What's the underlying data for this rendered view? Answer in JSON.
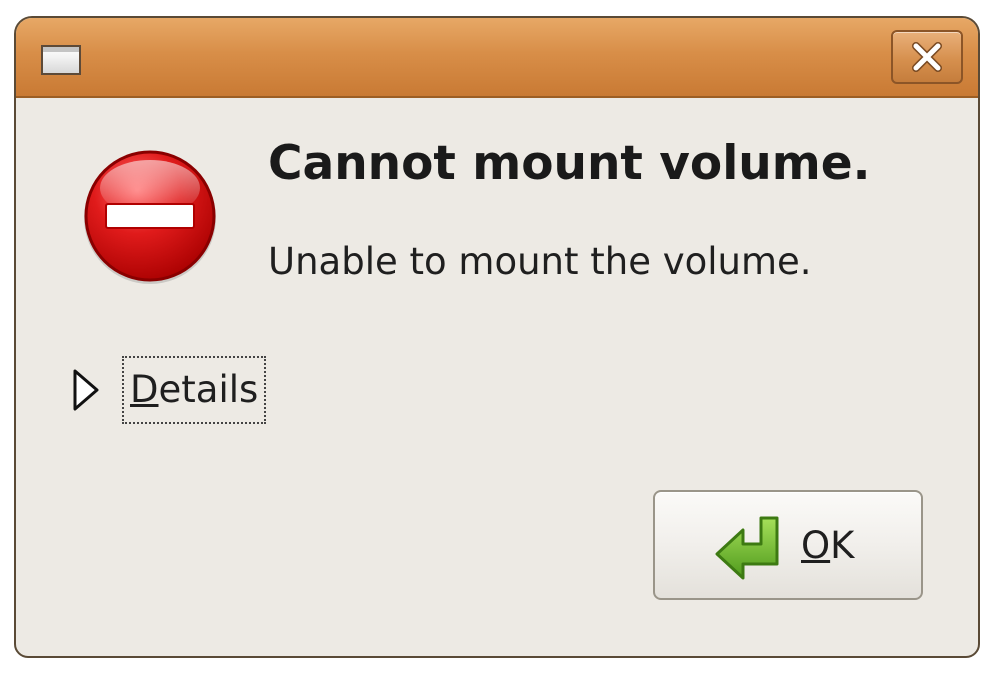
{
  "dialog": {
    "heading": "Cannot mount volume.",
    "message": "Unable to mount the volume.",
    "details": {
      "mnemonic": "D",
      "rest": "etails"
    },
    "ok_button": {
      "mnemonic": "O",
      "rest": "K"
    }
  },
  "icons": {
    "window_menu": "window-menu-icon",
    "close": "close-icon",
    "error": "no-entry-error-icon",
    "expander": "triangle-right-icon",
    "ok": "green-enter-arrow-icon"
  },
  "colors": {
    "titlebar": "#d88e48",
    "dialog_background": "#edeae4",
    "error_red": "#cc0000",
    "ok_arrow_green": "#6fbf2a"
  }
}
